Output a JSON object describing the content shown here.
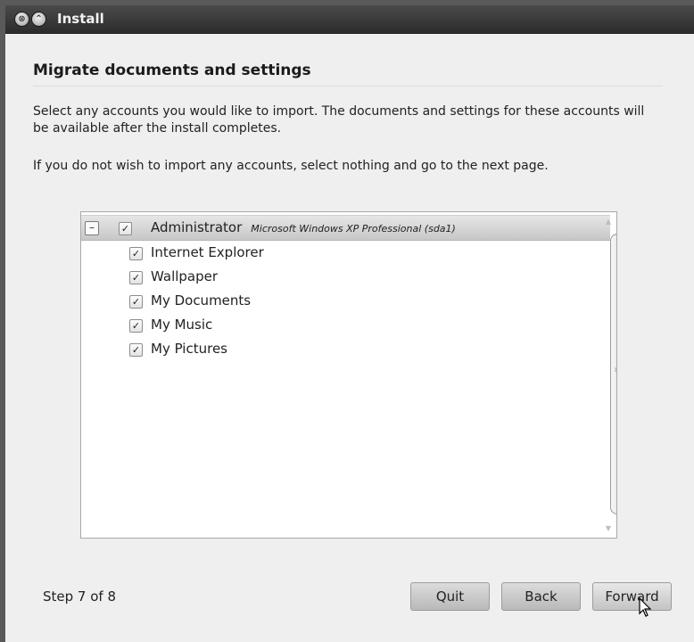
{
  "window": {
    "title": "Install",
    "close_glyph": "⊗",
    "minimize_glyph": "⌃"
  },
  "page": {
    "heading": "Migrate documents and settings",
    "description": "Select any accounts you would like to import.  The documents and settings for these accounts will be available after the install completes.",
    "description2": "If you do not wish to import any accounts, select nothing and go to the next page."
  },
  "tree": {
    "parent": {
      "expander": "–",
      "checked": true,
      "check_glyph": "✓",
      "label": "Administrator",
      "sublabel": "Microsoft Windows XP Professional (sda1)"
    },
    "children": [
      {
        "label": "Internet Explorer",
        "checked": true,
        "check_glyph": "✓"
      },
      {
        "label": "Wallpaper",
        "checked": true,
        "check_glyph": "✓"
      },
      {
        "label": "My Documents",
        "checked": true,
        "check_glyph": "✓"
      },
      {
        "label": "My Music",
        "checked": true,
        "check_glyph": "✓"
      },
      {
        "label": "My Pictures",
        "checked": true,
        "check_glyph": "✓"
      }
    ],
    "scroll_up_glyph": "▲",
    "scroll_down_glyph": "▼",
    "grip_glyph": "≡"
  },
  "footer": {
    "step": "Step 7 of 8",
    "quit_label": "Quit",
    "back_label": "Back",
    "forward_label": "Forward"
  },
  "colors": {
    "title_bar": "#2c2c2c",
    "window_bg": "#efefef",
    "selected_row": "#c7c7c7"
  }
}
